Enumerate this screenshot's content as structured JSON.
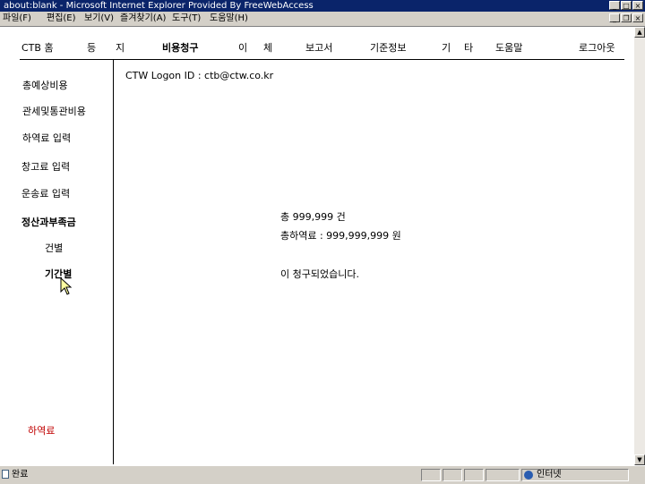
{
  "window": {
    "title": "about:blank - Microsoft Internet Explorer Provided By FreeWebAccess",
    "minimize": "_",
    "maximize": "□",
    "close": "×"
  },
  "menubar": {
    "items": [
      "파일(F)",
      "편집(E)",
      "보기(V)",
      "즐겨찾기(A)",
      "도구(T)",
      "도움말(H)"
    ],
    "minimize": "_",
    "restore": "❐",
    "close": "×"
  },
  "topnav": {
    "items": [
      "CTB 홈",
      "등",
      "지",
      "비용청구",
      "이",
      "체",
      "보고서",
      "기준정보",
      "기",
      "타",
      "도움말",
      "로그아웃"
    ]
  },
  "sidebar": {
    "items": [
      "총예상비용",
      "관세및통관비용",
      "하역료 입력",
      "창고료 입력",
      "운송료 입력",
      "정산과부족금",
      "건별",
      "기간별"
    ],
    "footer": "하역료"
  },
  "main": {
    "logon": "CTW Logon ID : ctb@ctw.co.kr",
    "total_count": "총 999,999 건",
    "total_amount": "총하역료 : 999,999,999 원",
    "message": "이 청구되었습니다."
  },
  "statusbar": {
    "left": "완료",
    "zone": "인터넷"
  },
  "colors": {
    "titlebar": "#0a246a",
    "chrome": "#d4d0c8",
    "footer_link": "#c00000"
  }
}
